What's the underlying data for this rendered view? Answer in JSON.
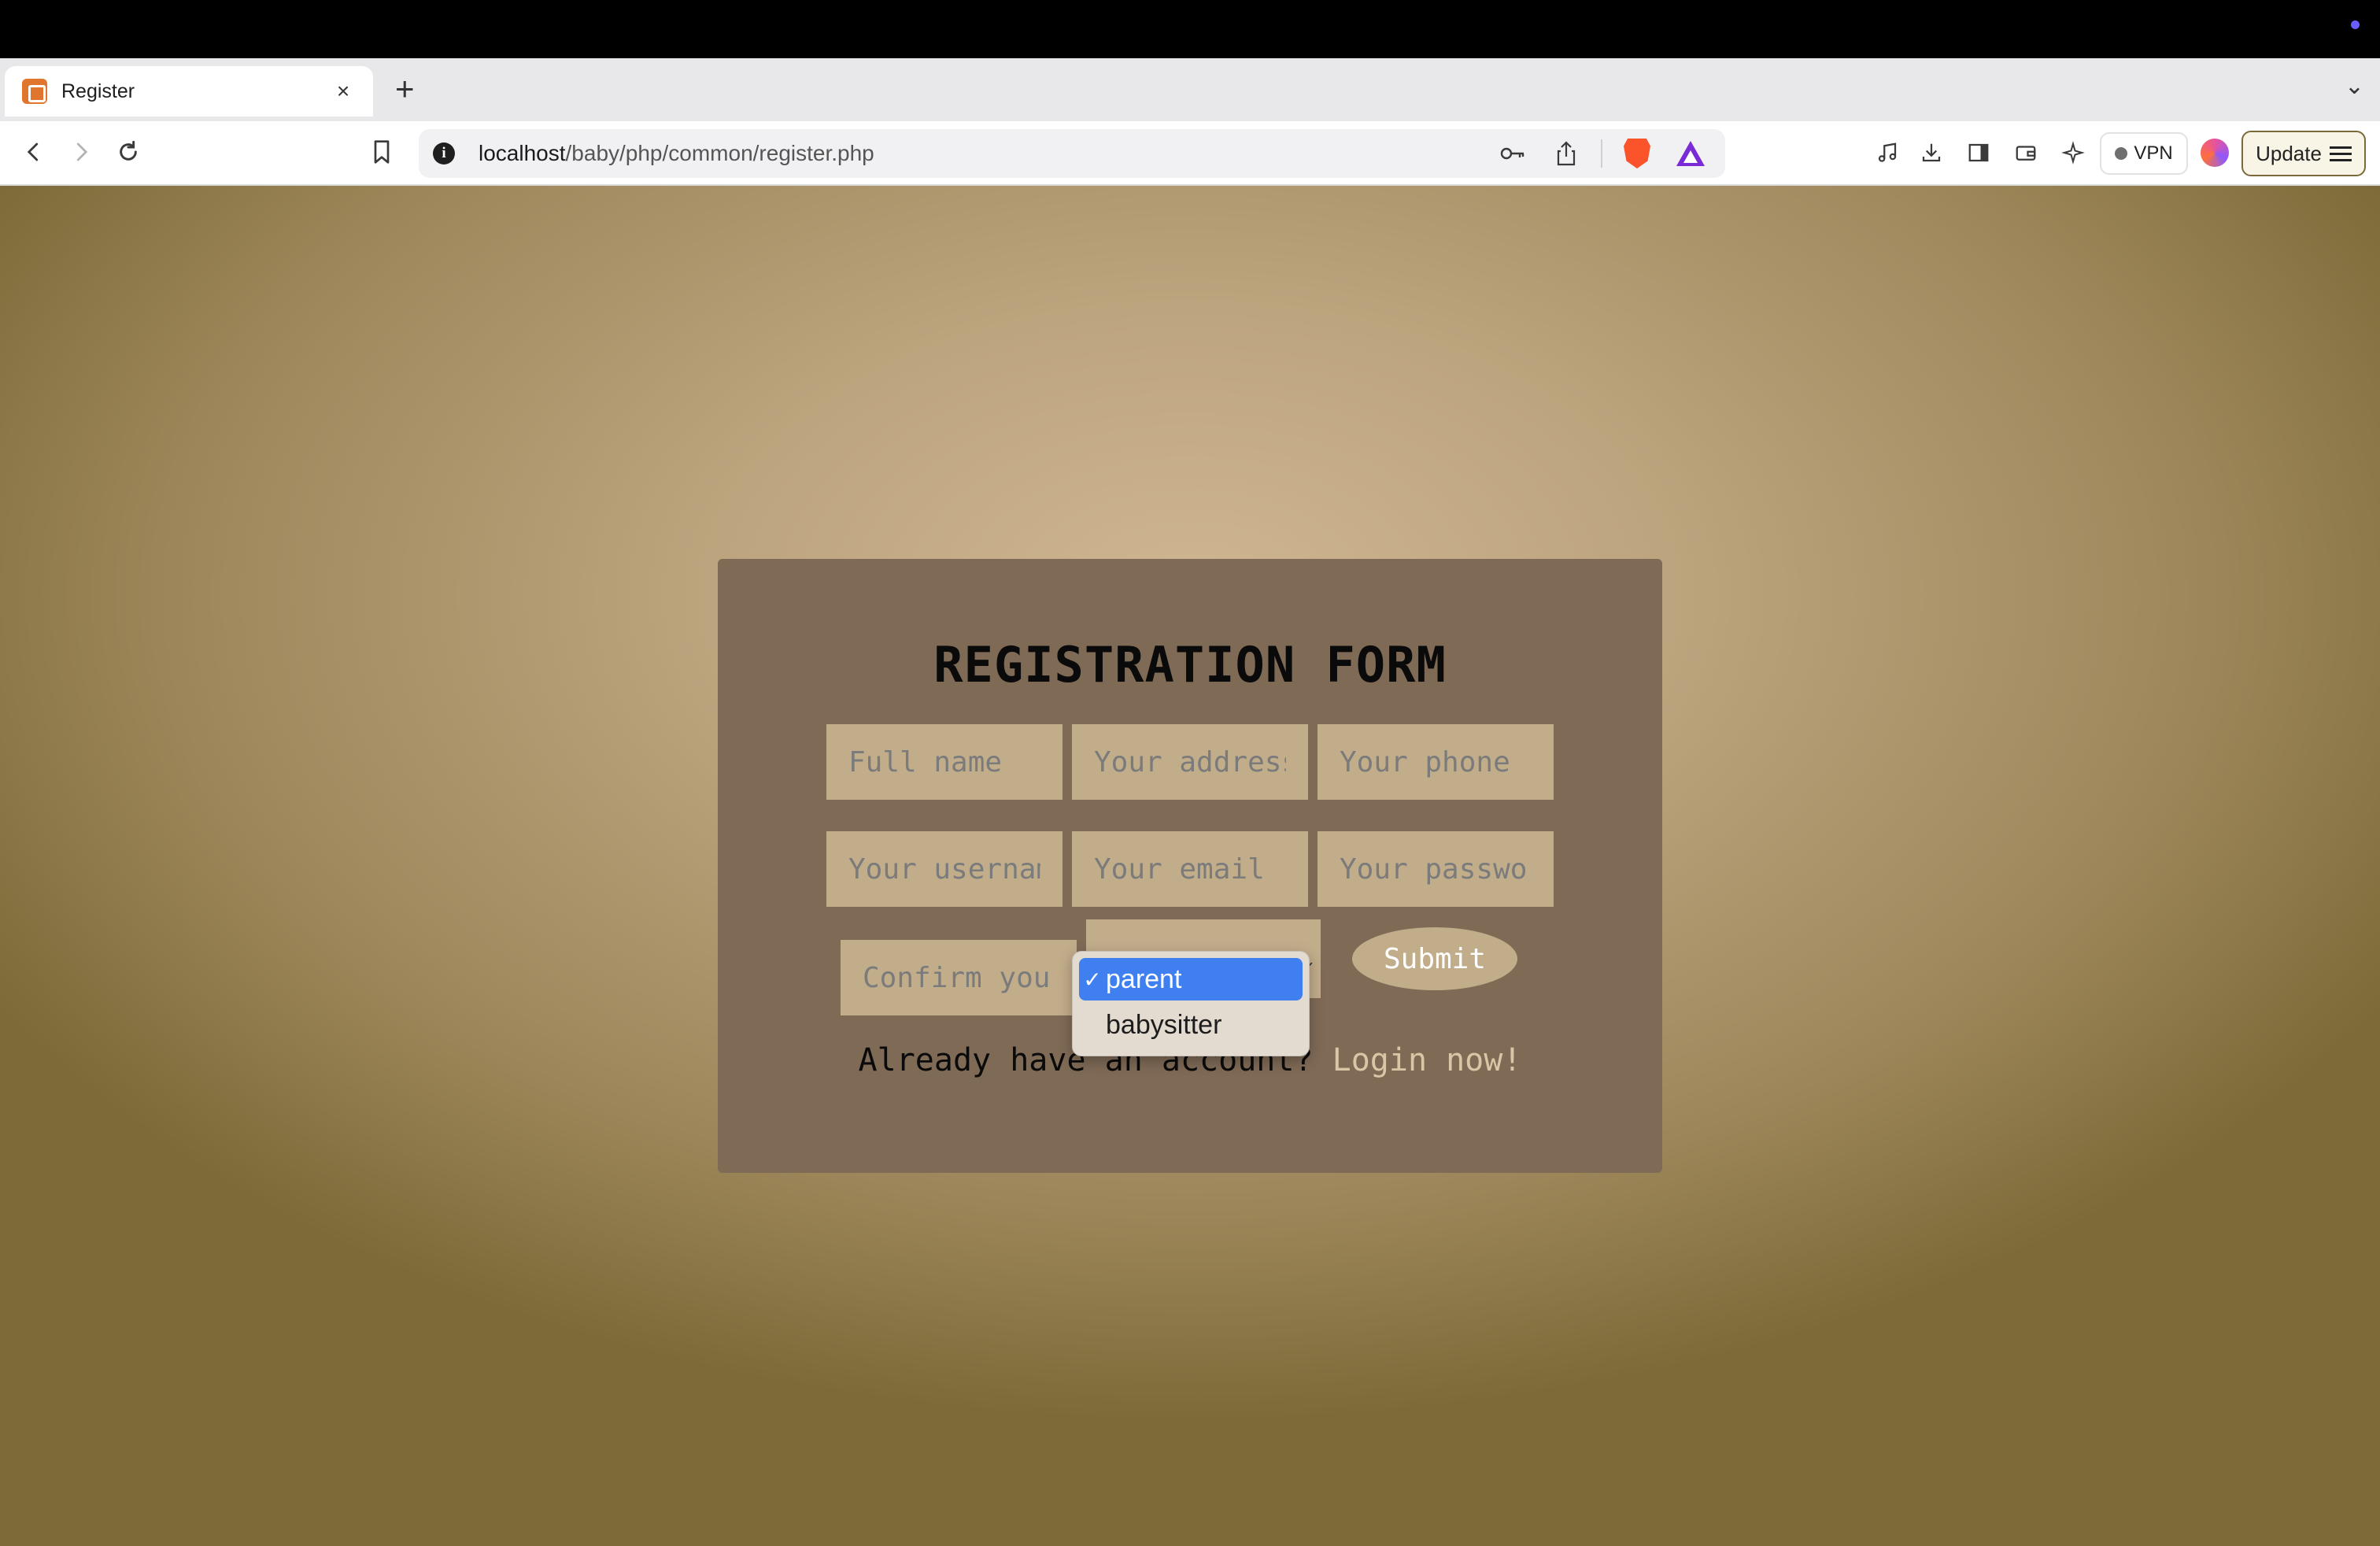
{
  "browser": {
    "tab": {
      "title": "Register",
      "close_symbol": "×"
    },
    "new_tab_symbol": "+",
    "tab_list_symbol": "⌄",
    "url": {
      "host": "localhost",
      "path": "/baby/php/common/register.php"
    },
    "vpn_label": "VPN",
    "update_label": "Update"
  },
  "form": {
    "title": "REGISTRATION FORM",
    "fields": {
      "full_name": "Full name",
      "address": "Your address",
      "phone": "Your phone",
      "username": "Your username",
      "email": "Your email",
      "password": "Your password",
      "confirm": "Confirm your password"
    },
    "role_select": {
      "options": [
        "parent",
        "babysitter"
      ],
      "selected": "parent",
      "check_symbol": "✓"
    },
    "submit_label": "Submit",
    "login_prompt": "Already have an account?",
    "login_link": "Login now!"
  },
  "colors": {
    "card": "#7f6a56",
    "field": "#c2ad8b",
    "link": "#d8c6a6",
    "dropdown_highlight": "#3f7fef"
  }
}
